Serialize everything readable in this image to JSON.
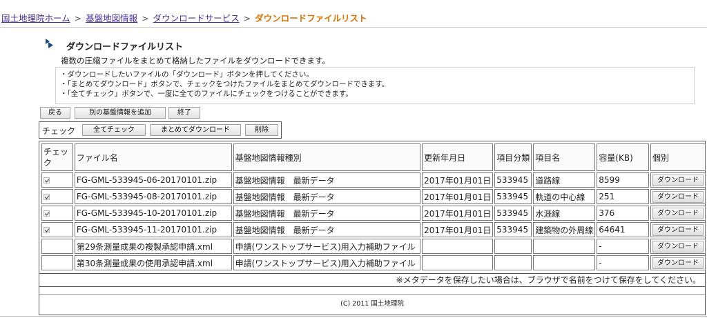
{
  "breadcrumb": {
    "home": "国土地理院ホーム",
    "level2": "基盤地図情報",
    "level3": "ダウンロードサービス",
    "current": "ダウンロードファイルリスト",
    "separator": ">"
  },
  "page": {
    "title": "ダウンロードファイルリスト",
    "subtitle": "複数の圧縮ファイルをまとめて格納したファイルをダウンロードできます。"
  },
  "notes": [
    "・ダウンロードしたいファイルの「ダウンロード」ボタンを押してください。",
    "・「まとめてダウンロード」ボタンで、チェックをつけたファイルをまとめてダウンロードできます。",
    "・「全てチェック」ボタンで、一度に全てのファイルにチェックをつけることができます。"
  ],
  "toolbar": {
    "back": "戻る",
    "add": "別の基盤情報を追加",
    "finish": "終了"
  },
  "check_group": {
    "label": "チェック",
    "check_all": "全てチェック",
    "bulk_download": "まとめてダウンロード",
    "delete": "削除"
  },
  "table": {
    "headers": [
      "チェック",
      "ファイル名",
      "基盤地図情報種別",
      "更新年月日",
      "項目分類",
      "項目名",
      "容量(KB)",
      "個別"
    ],
    "rows": [
      {
        "checked": true,
        "file": "FG-GML-533945-06-20170101.zip",
        "type": "基盤地図情報　最新データ",
        "date": "2017年01月01日",
        "code": "533945",
        "item": "道路線",
        "size": "8599",
        "button": "ダウンロード"
      },
      {
        "checked": true,
        "file": "FG-GML-533945-08-20170101.zip",
        "type": "基盤地図情報　最新データ",
        "date": "2017年01月01日",
        "code": "533945",
        "item": "軌道の中心線",
        "size": "251",
        "button": "ダウンロード"
      },
      {
        "checked": true,
        "file": "FG-GML-533945-10-20170101.zip",
        "type": "基盤地図情報　最新データ",
        "date": "2017年01月01日",
        "code": "533945",
        "item": "水涯線",
        "size": "376",
        "button": "ダウンロード"
      },
      {
        "checked": true,
        "file": "FG-GML-533945-11-20170101.zip",
        "type": "基盤地図情報　最新データ",
        "date": "2017年01月01日",
        "code": "533945",
        "item": "建築物の外周線",
        "size": "64641",
        "button": "ダウンロード"
      },
      {
        "checked": false,
        "file": "第29条測量成果の複製承認申請.xml",
        "type": "申請(ワンストップサービス)用入力補助ファイル",
        "date": "",
        "code": "",
        "item": "",
        "size": "-",
        "button": "ダウンロード"
      },
      {
        "checked": false,
        "file": "第30条測量成果の使用承認申請.xml",
        "type": "申請(ワンストップサービス)用入力補助ファイル",
        "date": "",
        "code": "",
        "item": "",
        "size": "-",
        "button": "ダウンロード"
      }
    ]
  },
  "metadata_note": "※メタデータを保存したい場合は、ブラウザで名前をつけて保存をしてください。",
  "copyright": "(C) 2011 国土地理院",
  "colors": {
    "link": "#4b2fa0",
    "current": "#e07000",
    "border": "#777777"
  }
}
